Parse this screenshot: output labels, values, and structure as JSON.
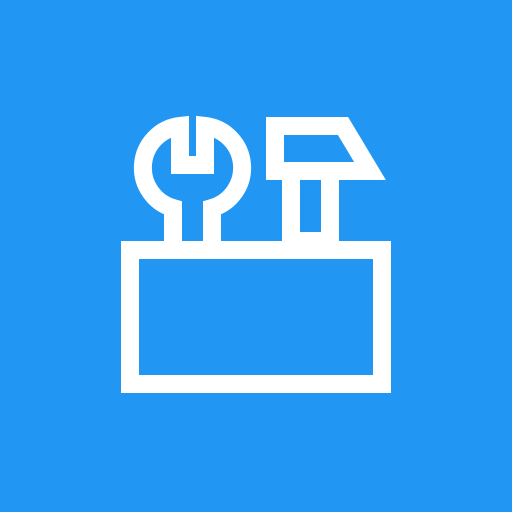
{
  "app_icon": {
    "icon": "toolbox-icon",
    "background_color": "#2196F3",
    "foreground_color": "#FFFFFF",
    "parts": [
      "wrench-icon",
      "hammer-icon",
      "box-icon"
    ]
  }
}
